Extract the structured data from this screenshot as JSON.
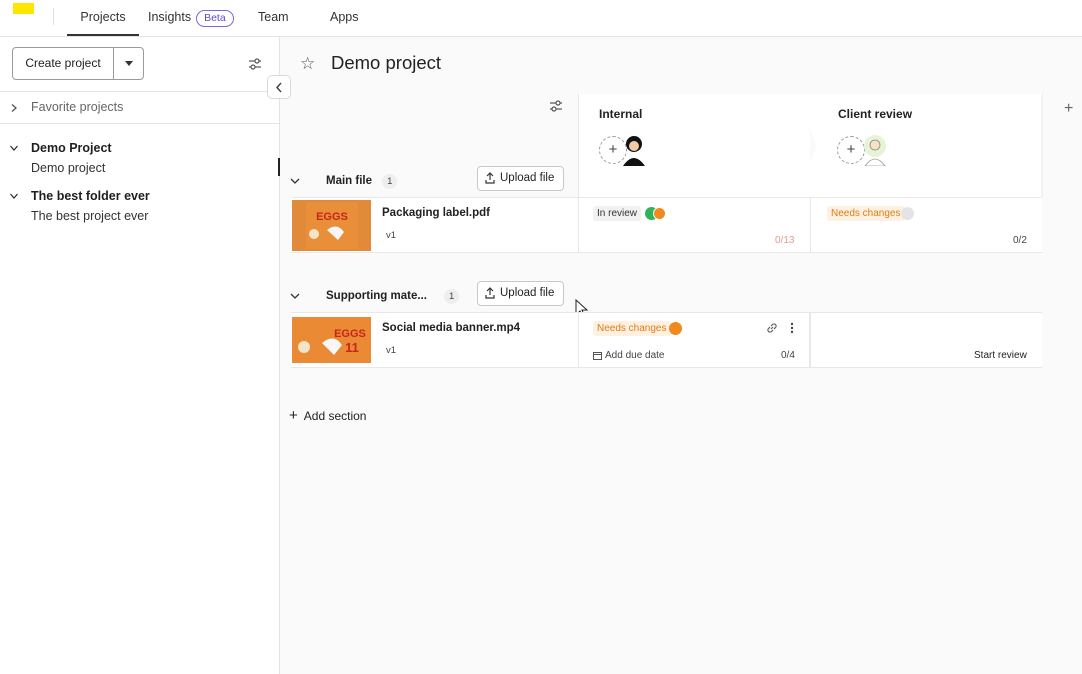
{
  "nav": {
    "tabs": [
      {
        "label": "Projects"
      },
      {
        "label": "Insights",
        "badge": "Beta"
      },
      {
        "label": "Team"
      },
      {
        "label": "Apps"
      }
    ]
  },
  "sidebar": {
    "create_label": "Create project",
    "favorites_label": "Favorite projects",
    "folders": [
      {
        "title": "Demo Project",
        "project": "Demo project"
      },
      {
        "title": "The best folder ever",
        "project": "The best project ever"
      }
    ]
  },
  "main": {
    "title": "Demo project",
    "columns": [
      {
        "name": "Internal"
      },
      {
        "name": "Client review"
      }
    ],
    "sections": [
      {
        "name": "Main file",
        "count": "1",
        "upload_label": "Upload file",
        "file": {
          "name": "Packaging label.pdf",
          "version": "v1",
          "internal_status": "In review",
          "internal_count": "0/13",
          "client_status": "Needs changes",
          "client_count": "0/2"
        }
      },
      {
        "name": "Supporting mate...",
        "count": "1",
        "upload_label": "Upload file",
        "file": {
          "name": "Social media banner.mp4",
          "version": "v1",
          "internal_status": "Needs changes",
          "due_label": "Add due date",
          "internal_count": "0/4",
          "client_action": "Start review"
        }
      }
    ],
    "add_section_label": "Add section"
  },
  "colors": {
    "accent_orange": "#f08a1c",
    "status_green": "#2fb45a",
    "logo_yellow": "#ffe600",
    "beta_purple": "#5b4ccf"
  }
}
